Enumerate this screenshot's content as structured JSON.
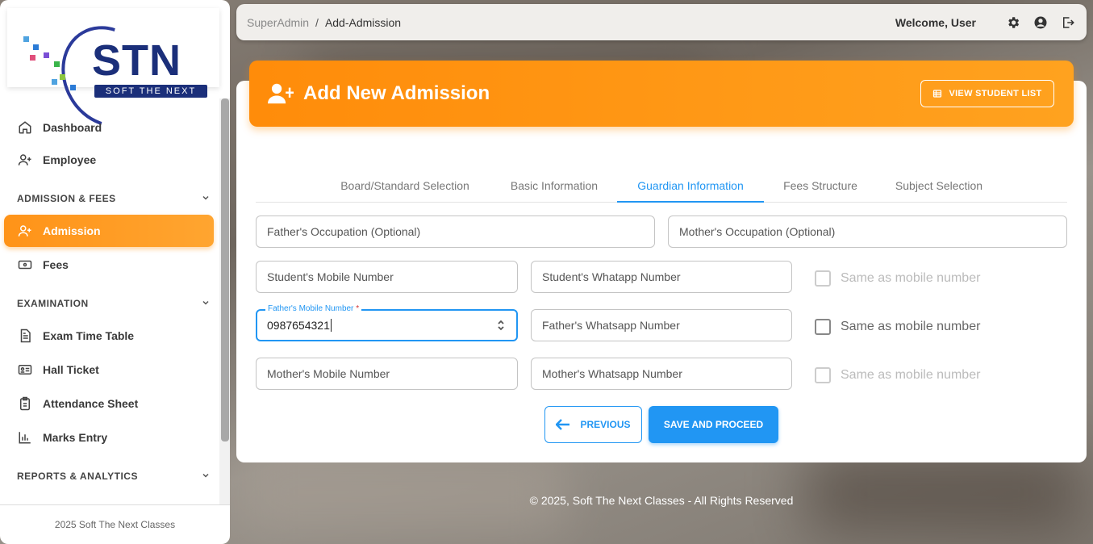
{
  "sidebar": {
    "logo": {
      "text": "STN",
      "subtitle": "SOFT THE NEXT"
    },
    "items": [
      {
        "label": "Dashboard",
        "icon": "home-icon"
      },
      {
        "label": "Employee",
        "icon": "user-plus-icon"
      }
    ],
    "sections": [
      {
        "label": "ADMISSION & FEES",
        "items": [
          {
            "label": "Admission",
            "icon": "user-plus-icon",
            "active": true
          },
          {
            "label": "Fees",
            "icon": "money-icon"
          }
        ]
      },
      {
        "label": "EXAMINATION",
        "items": [
          {
            "label": "Exam Time Table",
            "icon": "document-icon"
          },
          {
            "label": "Hall Ticket",
            "icon": "id-card-icon"
          },
          {
            "label": "Attendance Sheet",
            "icon": "clipboard-icon"
          },
          {
            "label": "Marks Entry",
            "icon": "bar-chart-icon"
          }
        ]
      },
      {
        "label": "REPORTS & ANALYTICS",
        "items": []
      }
    ],
    "footer": "2025 Soft The Next Classes"
  },
  "topbar": {
    "breadcrumb_root": "SuperAdmin",
    "breadcrumb_sep": "/",
    "breadcrumb_current": "Add-Admission",
    "welcome": "Welcome, User"
  },
  "header": {
    "title": "Add New Admission",
    "view_list_label": "VIEW STUDENT LIST"
  },
  "tabs": [
    {
      "label": "Board/Standard Selection",
      "active": false
    },
    {
      "label": "Basic Information",
      "active": false
    },
    {
      "label": "Guardian Information",
      "active": true
    },
    {
      "label": "Fees Structure",
      "active": false
    },
    {
      "label": "Subject Selection",
      "active": false
    }
  ],
  "form": {
    "father_occupation": "Father's Occupation (Optional)",
    "mother_occupation": "Mother's Occupation (Optional)",
    "student_mobile": "Student's Mobile Number",
    "student_whatsapp": "Student's Whatapp Number",
    "father_mobile_label": "Father's Mobile Number",
    "father_mobile_required": "*",
    "father_mobile_value": "0987654321",
    "father_whatsapp": "Father's Whatsapp Number",
    "mother_mobile": "Mother's Mobile Number",
    "mother_whatsapp": "Mother's Whatsapp Number",
    "same_as_mobile": "Same as mobile number"
  },
  "buttons": {
    "previous": "PREVIOUS",
    "save": "SAVE AND PROCEED"
  },
  "footer": {
    "copyright": "© 2025, Soft The Next Classes - All Rights Reserved"
  },
  "colors": {
    "accent_orange": "#ff9318",
    "primary_blue": "#2196f3"
  }
}
